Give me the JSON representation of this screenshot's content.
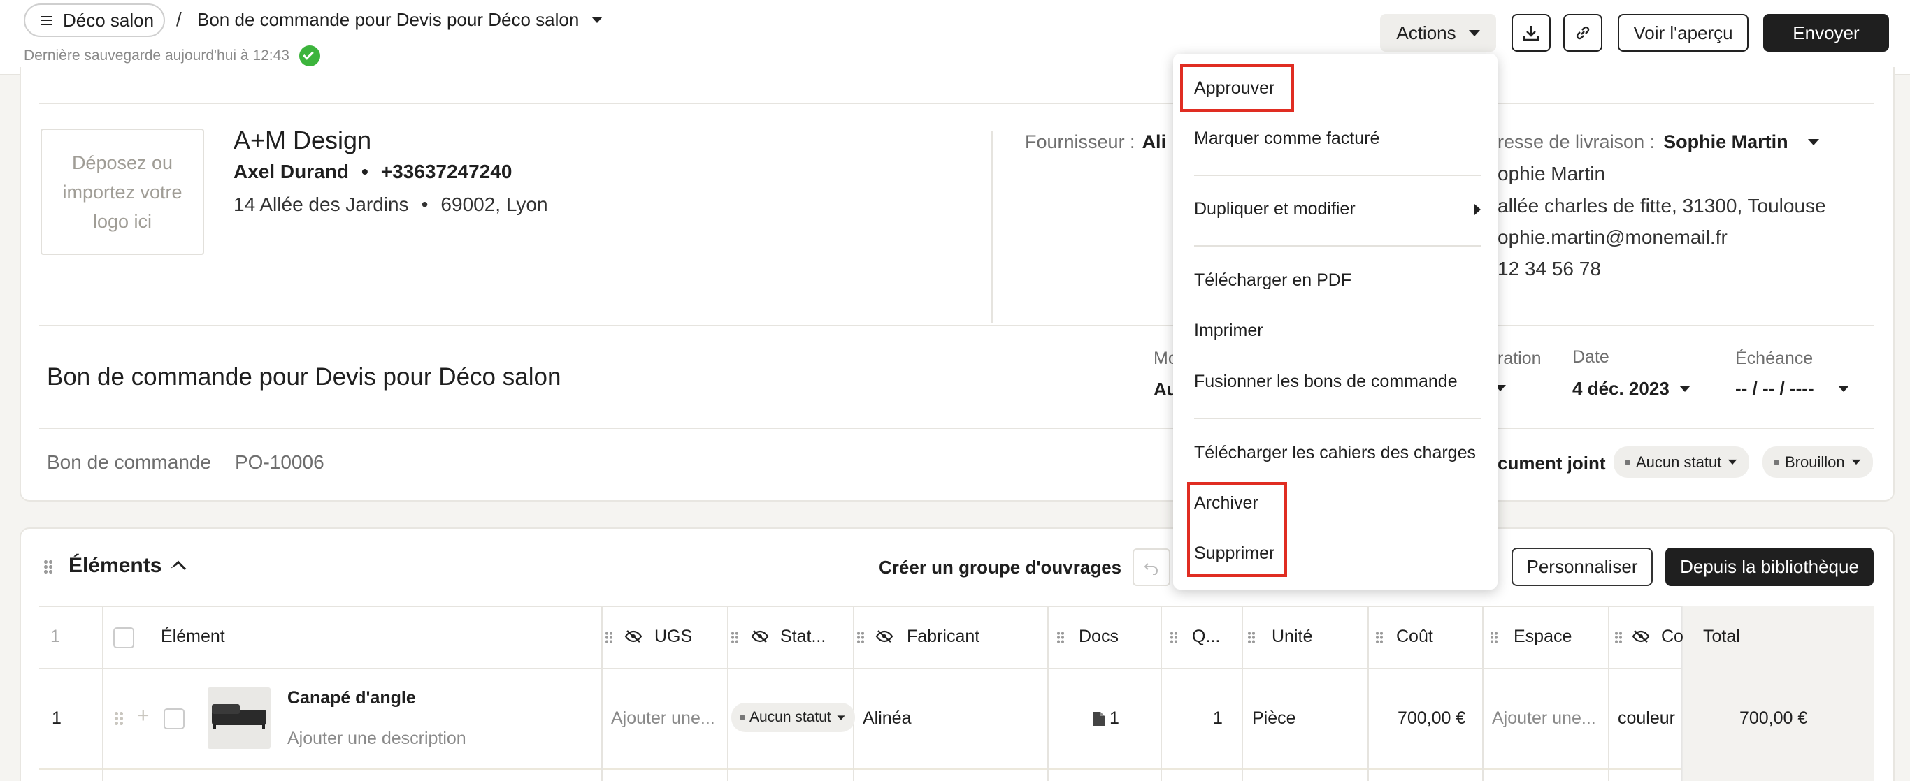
{
  "topbar": {
    "project_label": "Déco salon",
    "separator": "/",
    "doc_title": "Bon de commande pour Devis pour Déco salon",
    "last_saved": "Dernière sauvegarde aujourd'hui à 12:43",
    "actions_label": "Actions",
    "preview_label": "Voir l'aperçu",
    "send_label": "Envoyer"
  },
  "company": {
    "logo_placeholder": "Déposez ou importez votre logo ici",
    "name": "A+M Design",
    "contact_name": "Axel Durand",
    "bullet": "•",
    "phone": "+33637247240",
    "street": "14 Allée des Jardins",
    "city": "69002, Lyon"
  },
  "supplier": {
    "label": "Fournisseur :",
    "value": "Ali"
  },
  "delivery": {
    "label": "resse de livraison :",
    "name_selected": "Sophie Martin",
    "line1": "ophie Martin",
    "line2": "allée charles de fitte, 31300, Toulouse",
    "line3": "ophie.martin@monemail.fr",
    "line4": "12 34 56 78"
  },
  "doc": {
    "title": "Bon de commande pour Devis pour Déco salon",
    "mode_label": "Mo",
    "mode_value": "Au",
    "duration_label": "ration",
    "date_label": "Date",
    "date_value": "4 déc. 2023",
    "due_label": "Échéance",
    "due_value": "-- / -- / ----",
    "po_label": "Bon de commande",
    "po_number": "PO-10006",
    "attachment_label": "cument joint",
    "status_badge": "Aucun statut",
    "draft_badge": "Brouillon"
  },
  "elements": {
    "title": "Éléments",
    "create_group": "Créer un groupe d'ouvrages",
    "customize": "Personnaliser",
    "from_library": "Depuis la bibliothèque",
    "columns": {
      "count": "1",
      "element": "Élément",
      "ugs": "UGS",
      "status": "Stat...",
      "maker": "Fabricant",
      "docs": "Docs",
      "qty": "Q...",
      "unit": "Unité",
      "cost": "Coût",
      "space": "Espace",
      "co": "Co",
      "total": "Total"
    },
    "rows": [
      {
        "index": "1",
        "name": "Canapé d'angle",
        "description": "Ajouter une description",
        "ugs": "Ajouter une...",
        "status": "Aucun statut",
        "maker": "Alinéa",
        "docs": "1",
        "qty": "1",
        "unit": "Pièce",
        "cost": "700,00 €",
        "space": "Ajouter une...",
        "co": "couleur :",
        "total": "700,00 €"
      }
    ]
  },
  "actions_menu": {
    "items": [
      "Approuver",
      "Marquer comme facturé",
      "Dupliquer et modifier",
      "Télécharger en PDF",
      "Imprimer",
      "Fusionner les bons de commande",
      "Télécharger les cahiers des charges",
      "Archiver",
      "Supprimer"
    ]
  },
  "colors": {
    "accent_dark": "#1f1f1f",
    "highlight": "#e02d22",
    "success": "#3cb43c"
  }
}
